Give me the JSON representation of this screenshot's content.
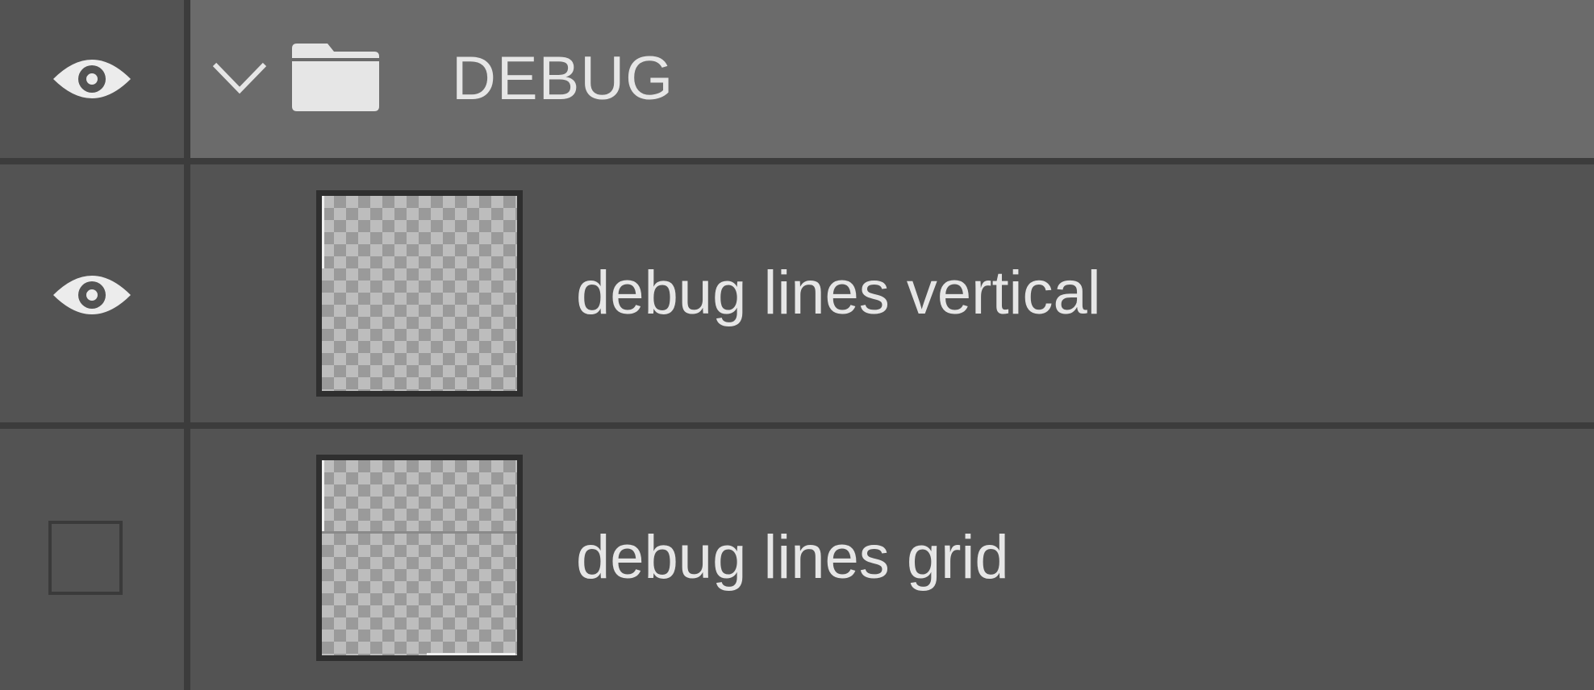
{
  "layers_panel": {
    "group": {
      "name": "DEBUG",
      "visible": true,
      "expanded": true,
      "icons": {
        "visibility": "eye-icon",
        "expand": "chevron-down-icon",
        "type": "folder-icon"
      }
    },
    "layers": [
      {
        "name": "debug lines vertical",
        "visible": true,
        "visibility_icon": "eye-icon"
      },
      {
        "name": "debug lines grid",
        "visible": false,
        "visibility_icon": "empty-checkbox"
      }
    ]
  },
  "colors": {
    "panel_bg": "#535353",
    "group_row_bg": "#6b6b6b",
    "divider": "#3c3c3c",
    "text": "#e6e6e6"
  }
}
